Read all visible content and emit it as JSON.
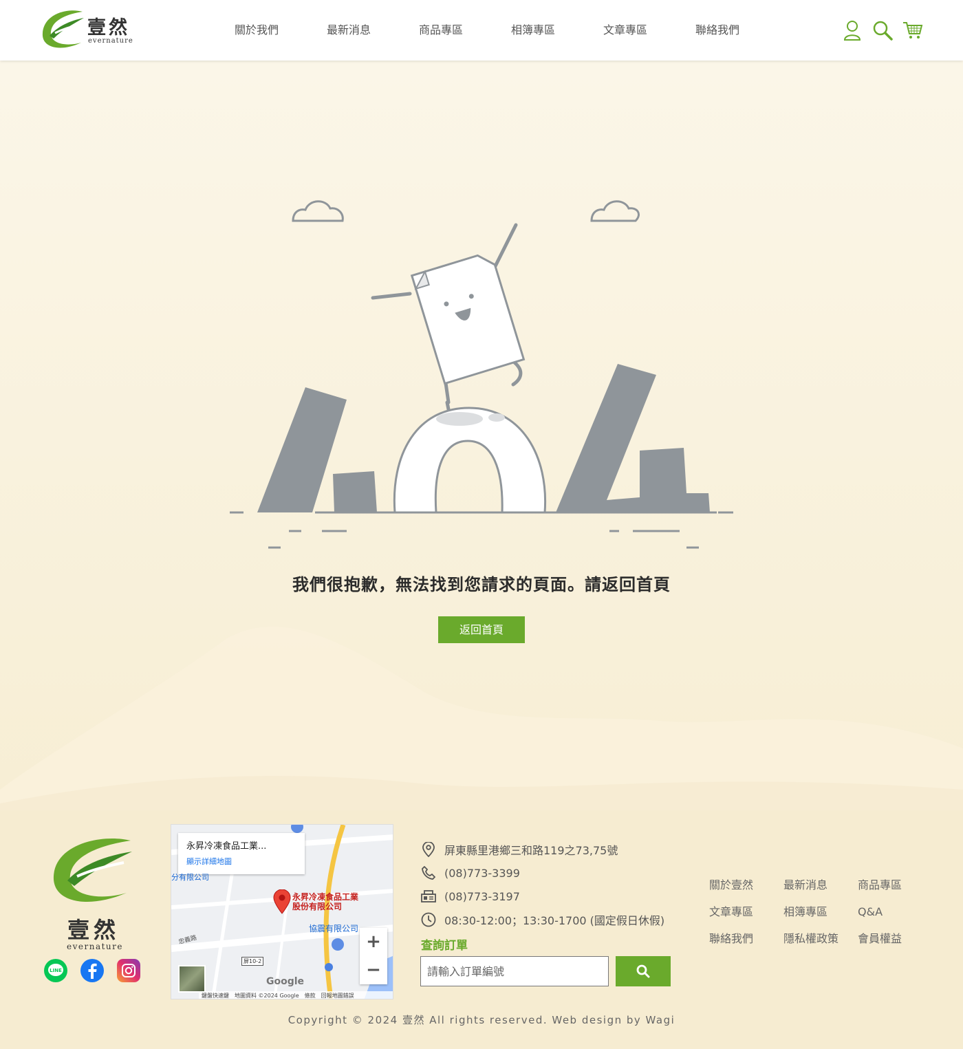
{
  "brand": {
    "name_cn": "壹然",
    "name_en": "evernature",
    "accent_color": "#6aaa2c"
  },
  "nav": {
    "items": [
      "關於我們",
      "最新消息",
      "商品專區",
      "相簿專區",
      "文章專區",
      "聯絡我們"
    ]
  },
  "header_icons": [
    "user-icon",
    "search-icon",
    "cart-icon"
  ],
  "error": {
    "message": "我們很抱歉，無法找到您請求的頁面。請返回首頁",
    "button_label": "返回首頁"
  },
  "footer": {
    "social": [
      "line-icon",
      "facebook-icon",
      "instagram-icon"
    ],
    "map": {
      "card_title": "永昇冷凍食品工業...",
      "card_link": "顯示詳細地圖",
      "pin_label_line1": "永昇冷凍食品工業",
      "pin_label_line2": "股份有限公司",
      "label_company2": "協震有限公司",
      "label_partial": "分有限公司",
      "label_road": "忠義路",
      "label_route": "屏10-2",
      "google": "Google",
      "attribution": "鍵盤快速鍵　地圖資料 ©2024 Google　條款　回報地圖錯誤"
    },
    "contact": {
      "address": "屏東縣里港鄉三和路119之73,75號",
      "phone": "(08)773-3399",
      "fax": "(08)773-3197",
      "hours": "08:30-12:00；13:30-1700 (國定假日休假)"
    },
    "order": {
      "title": "查詢訂單",
      "placeholder": "請輸入訂單編號"
    },
    "links": [
      "關於壹然",
      "最新消息",
      "商品專區",
      "文章專區",
      "相簿專區",
      "Q&A",
      "聯絡我們",
      "隱私權政策",
      "會員權益"
    ],
    "copyright": "Copyright © 2024 壹然 All rights reserved. Web design by Wagi"
  }
}
